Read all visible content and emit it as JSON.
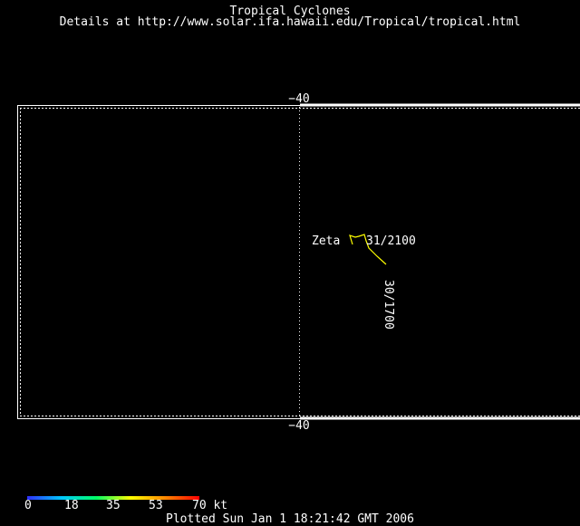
{
  "header": {
    "title": "Tropical Cyclones",
    "details": "Details at http://www.solar.ifa.hawaii.edu/Tropical/tropical.html"
  },
  "map": {
    "lat_top_label": "−40",
    "lat_bottom_label": "−40",
    "storm": {
      "name": "Zeta",
      "start_label": "30/1700",
      "end_label": "31/2100",
      "track_color": "#ffff00"
    }
  },
  "legend": {
    "ticks": [
      "0",
      "18",
      "35",
      "53",
      "70 kt"
    ],
    "colors": [
      "#3030ff",
      "#00c8ff",
      "#00ff66",
      "#ffff00",
      "#ff8800",
      "#ff0000"
    ]
  },
  "footer": {
    "plotted": "Plotted Sun Jan 1 18:21:42 GMT 2006"
  }
}
